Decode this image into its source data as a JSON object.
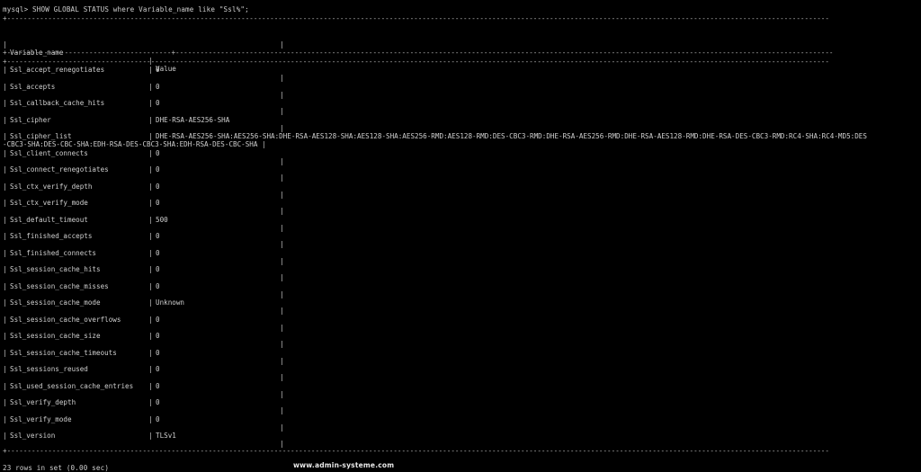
{
  "prompt_line": "mysql> SHOW GLOBAL STATUS where Variable_name like \"Ssl%\";",
  "header": {
    "col1": "Variable_name",
    "col2": "Value"
  },
  "rows": [
    {
      "name": "Ssl_accept_renegotiates",
      "value": "0"
    },
    {
      "name": "Ssl_accepts",
      "value": "0"
    },
    {
      "name": "Ssl_callback_cache_hits",
      "value": "0"
    },
    {
      "name": "Ssl_cipher",
      "value": "DHE-RSA-AES256-SHA"
    },
    {
      "name": "Ssl_cipher_list",
      "value": "DHE-RSA-AES256-SHA:AES256-SHA:DHE-RSA-AES128-SHA:AES128-SHA:AES256-RMD:AES128-RMD:DES-CBC3-RMD:DHE-RSA-AES256-RMD:DHE-RSA-AES128-RMD:DHE-RSA-DES-CBC3-RMD:RC4-SHA:RC4-MD5:DES",
      "value_wrap": "-CBC3-SHA:DES-CBC-SHA:EDH-RSA-DES-CBC3-SHA:EDH-RSA-DES-CBC-SHA |"
    },
    {
      "name": "Ssl_client_connects",
      "value": "0"
    },
    {
      "name": "Ssl_connect_renegotiates",
      "value": "0"
    },
    {
      "name": "Ssl_ctx_verify_depth",
      "value": "0"
    },
    {
      "name": "Ssl_ctx_verify_mode",
      "value": "0"
    },
    {
      "name": "Ssl_default_timeout",
      "value": "500"
    },
    {
      "name": "Ssl_finished_accepts",
      "value": "0"
    },
    {
      "name": "Ssl_finished_connects",
      "value": "0"
    },
    {
      "name": "Ssl_session_cache_hits",
      "value": "0"
    },
    {
      "name": "Ssl_session_cache_misses",
      "value": "0"
    },
    {
      "name": "Ssl_session_cache_mode",
      "value": "Unknown"
    },
    {
      "name": "Ssl_session_cache_overflows",
      "value": "0"
    },
    {
      "name": "Ssl_session_cache_size",
      "value": "0"
    },
    {
      "name": "Ssl_session_cache_timeouts",
      "value": "0"
    },
    {
      "name": "Ssl_sessions_reused",
      "value": "0"
    },
    {
      "name": "Ssl_used_session_cache_entries",
      "value": "0"
    },
    {
      "name": "Ssl_verify_depth",
      "value": "0"
    },
    {
      "name": "Ssl_verify_mode",
      "value": "0"
    },
    {
      "name": "Ssl_version",
      "value": "TLSv1"
    }
  ],
  "footer_line": "23 rows in set (0.00 sec)",
  "watermark": "www.admin-systeme.com"
}
